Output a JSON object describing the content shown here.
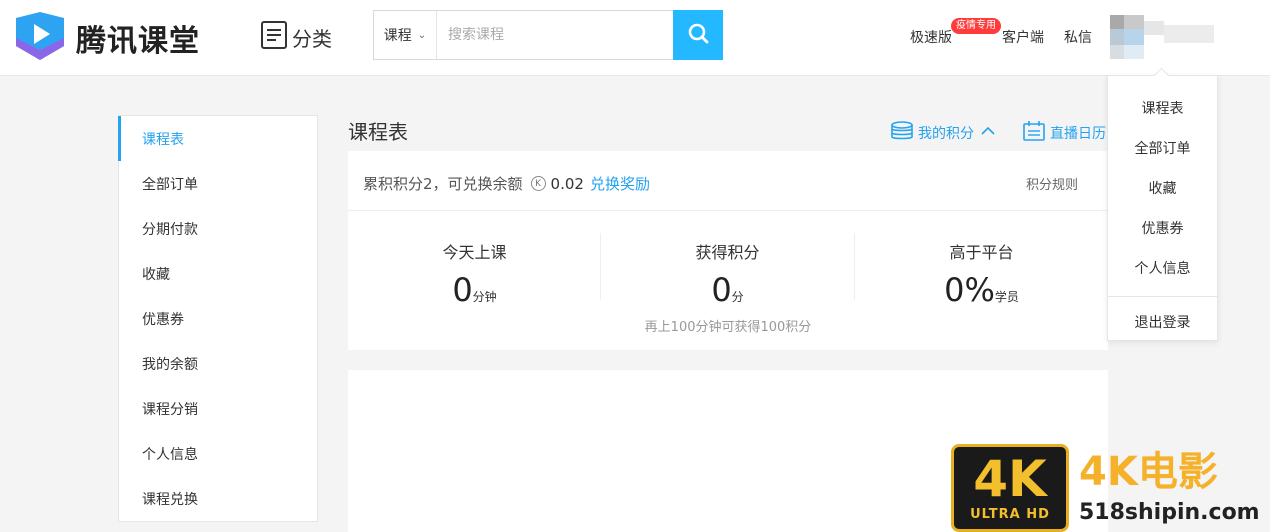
{
  "header": {
    "logo_text": "腾讯课堂",
    "category_label": "分类",
    "search": {
      "type_label": "课程",
      "placeholder": "搜索课程"
    },
    "nav": {
      "lite_label": "极速版",
      "lite_badge": "疫情专用",
      "client_label": "客户端",
      "message_label": "私信"
    }
  },
  "sidebar": {
    "items": [
      {
        "label": "课程表",
        "active": true
      },
      {
        "label": "全部订单"
      },
      {
        "label": "分期付款"
      },
      {
        "label": "收藏"
      },
      {
        "label": "优惠券"
      },
      {
        "label": "我的余额"
      },
      {
        "label": "课程分销"
      },
      {
        "label": "个人信息"
      },
      {
        "label": "课程兑换"
      }
    ]
  },
  "main": {
    "title": "课程表",
    "my_points_label": "我的积分",
    "live_calendar_label": "直播日历",
    "points": {
      "summary": "累积积分2，可兑换余额",
      "coin_symbol": "K",
      "balance": "0.02",
      "redeem_label": "兑换奖励",
      "rules_label": "积分规则",
      "stats": [
        {
          "label": "今天上课",
          "value": "0",
          "unit": "分钟"
        },
        {
          "label": "获得积分",
          "value": "0",
          "unit": "分"
        },
        {
          "label": "高于平台",
          "value": "0%",
          "unit": "学员"
        }
      ],
      "hint": "再上100分钟可获得100积分"
    }
  },
  "user_menu": {
    "items": [
      "课程表",
      "全部订单",
      "收藏",
      "优惠券",
      "个人信息"
    ],
    "logout_label": "退出登录"
  },
  "watermark": {
    "badge_main": "4K",
    "badge_sub": "ULTRA HD",
    "title": "4K电影",
    "url": "518shipin.com"
  },
  "colors": {
    "accent": "#23a3f0",
    "search_button": "#23b8ff",
    "badge": "#ff3c3c",
    "watermark_gold": "#f3bf2c"
  },
  "icons": [
    "logo-play-icon",
    "category-list-icon",
    "search-icon",
    "database-icon",
    "chevron-up-icon",
    "calendar-icon",
    "chevron-down-icon"
  ]
}
